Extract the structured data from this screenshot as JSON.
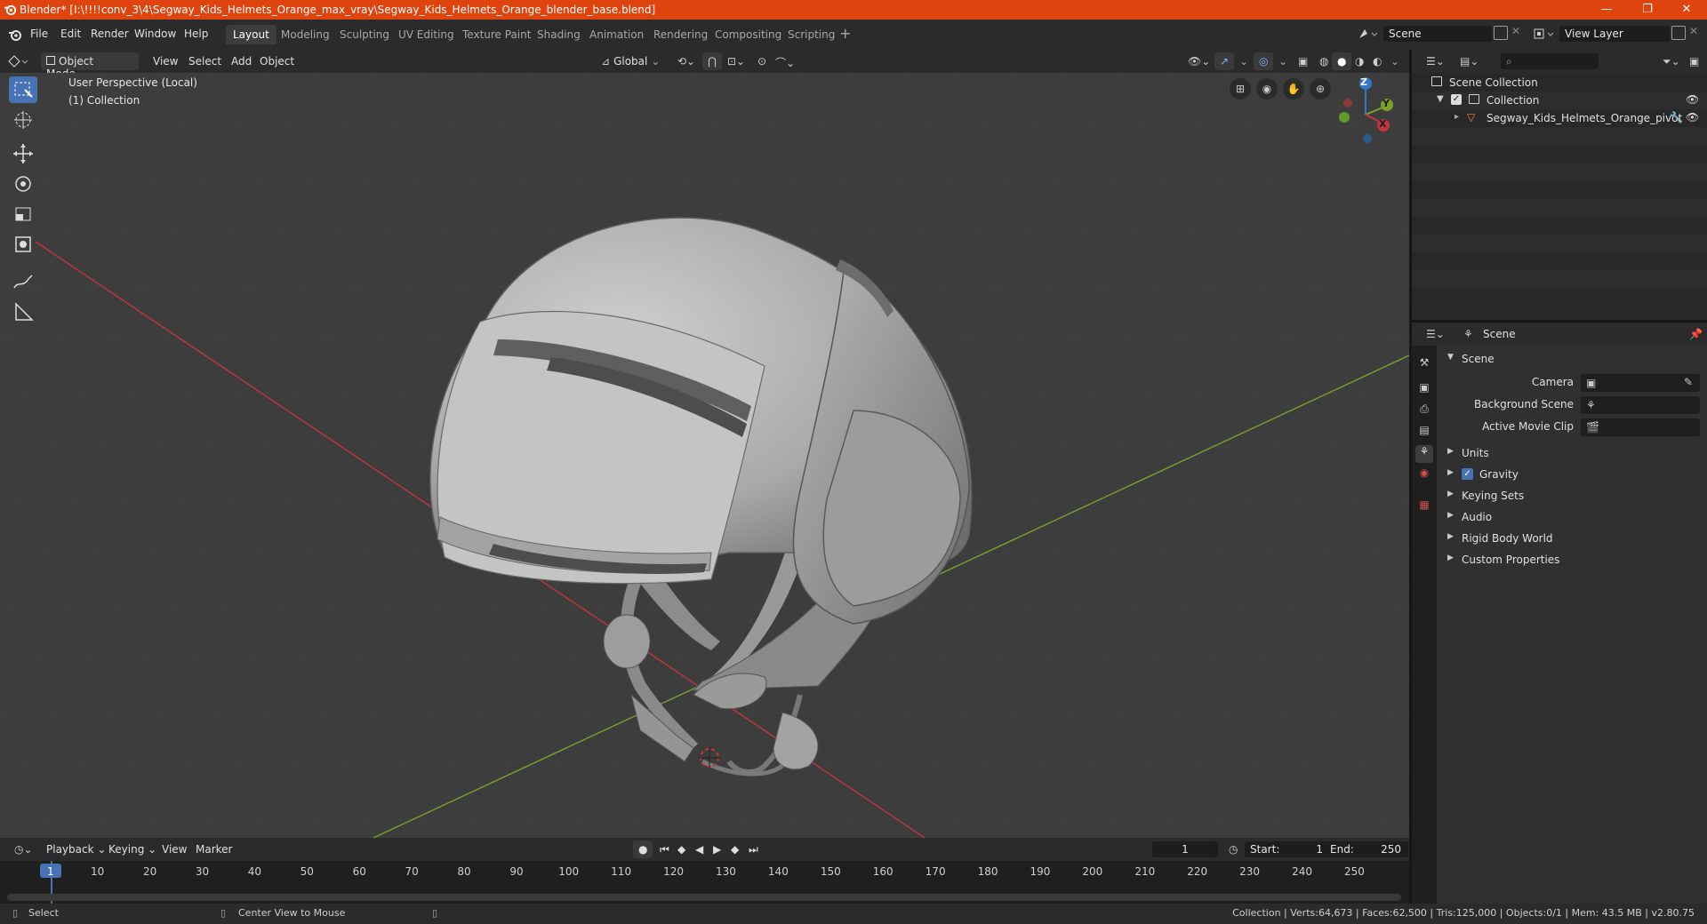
{
  "window": {
    "title": "Blender* [I:\\!!!!conv_3\\4\\Segway_Kids_Helmets_Orange_max_vray\\Segway_Kids_Helmets_Orange_blender_base.blend]",
    "minimize": "—",
    "restore": "❐",
    "close": "✕"
  },
  "menu": [
    "File",
    "Edit",
    "Render",
    "Window",
    "Help"
  ],
  "workspaces": [
    "Layout",
    "Modeling",
    "Sculpting",
    "UV Editing",
    "Texture Paint",
    "Shading",
    "Animation",
    "Rendering",
    "Compositing",
    "Scripting"
  ],
  "active_workspace": "Layout",
  "scene_field": "Scene",
  "view_layer_field": "View Layer",
  "viewport_header": {
    "mode": "Object Mode",
    "menus": [
      "View",
      "Select",
      "Add",
      "Object"
    ],
    "transform_orientation": "Global"
  },
  "viewport": {
    "perspective_label": "User Perspective (Local)",
    "collection_label": "(1) Collection",
    "gizmo_axes": [
      "Z",
      "Y",
      "X"
    ]
  },
  "outliner": {
    "rows": [
      {
        "label": "Scene Collection"
      },
      {
        "label": "Collection"
      },
      {
        "label": "Segway_Kids_Helmets_Orange_pivot"
      }
    ]
  },
  "properties": {
    "context": "Scene",
    "panel_title": "Scene",
    "fields": [
      {
        "label": "Camera"
      },
      {
        "label": "Background Scene"
      },
      {
        "label": "Active Movie Clip"
      }
    ],
    "subpanels": [
      "Units",
      "Gravity",
      "Keying Sets",
      "Audio",
      "Rigid Body World",
      "Custom Properties"
    ],
    "gravity_checked": true
  },
  "timeline": {
    "menus": [
      "Playback",
      "Keying",
      "View",
      "Marker"
    ],
    "current_frame": "1",
    "start_label": "Start:",
    "start": "1",
    "end_label": "End:",
    "end": "250",
    "ticks": [
      "1",
      "10",
      "20",
      "30",
      "40",
      "50",
      "60",
      "70",
      "80",
      "90",
      "100",
      "110",
      "120",
      "130",
      "140",
      "150",
      "160",
      "170",
      "180",
      "190",
      "200",
      "210",
      "220",
      "230",
      "240",
      "250"
    ]
  },
  "statusbar": {
    "left_action": "Select",
    "mid_action": "Center View to Mouse",
    "stats": "Collection | Verts:64,673 | Faces:62,500 | Tris:125,000 | Objects:0/1 | Mem: 43.5 MB | v2.80.75"
  },
  "colors": {
    "titlebar": "#e0440e",
    "accent": "#4772b3",
    "x_axis": "#c2353d",
    "y_axis": "#7aa12a",
    "z_axis": "#2f77c7"
  }
}
